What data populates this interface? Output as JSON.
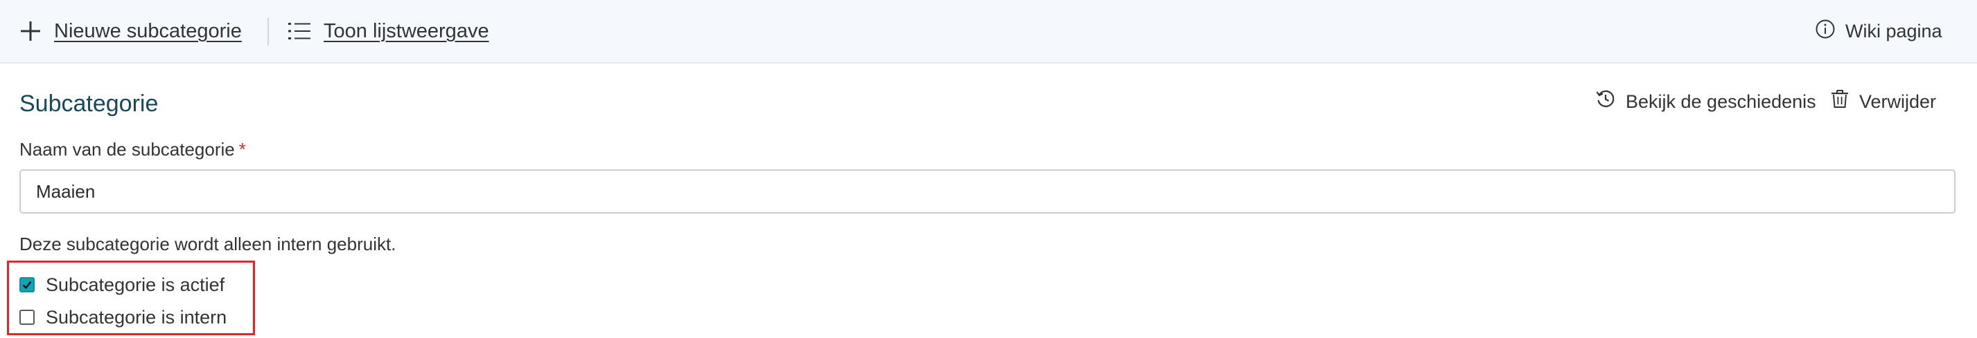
{
  "toolbar": {
    "new_subcategory_label": "Nieuwe subcategorie",
    "list_view_label": "Toon lijstweergave",
    "wiki_label": "Wiki pagina"
  },
  "section": {
    "title": "Subcategorie",
    "history_label": "Bekijk de geschiedenis",
    "delete_label": "Verwijder"
  },
  "form": {
    "name_label": "Naam van de subcategorie",
    "required_marker": "*",
    "name_value": "Maaien",
    "internal_note": "Deze subcategorie wordt alleen intern gebruikt.",
    "checkboxes": [
      {
        "label": "Subcategorie is actief",
        "checked": true
      },
      {
        "label": "Subcategorie is intern",
        "checked": false
      }
    ]
  },
  "icons": {
    "new": "plus-icon",
    "list": "list-icon",
    "wiki": "info-icon",
    "history": "history-icon",
    "delete": "trash-icon",
    "check": "checkmark-icon"
  },
  "colors": {
    "toolbar_bg": "#f5f8fc",
    "title": "#18485c",
    "checkbox_accent": "#10a3b9",
    "required": "#d9302c",
    "highlight": "#e0282a"
  }
}
